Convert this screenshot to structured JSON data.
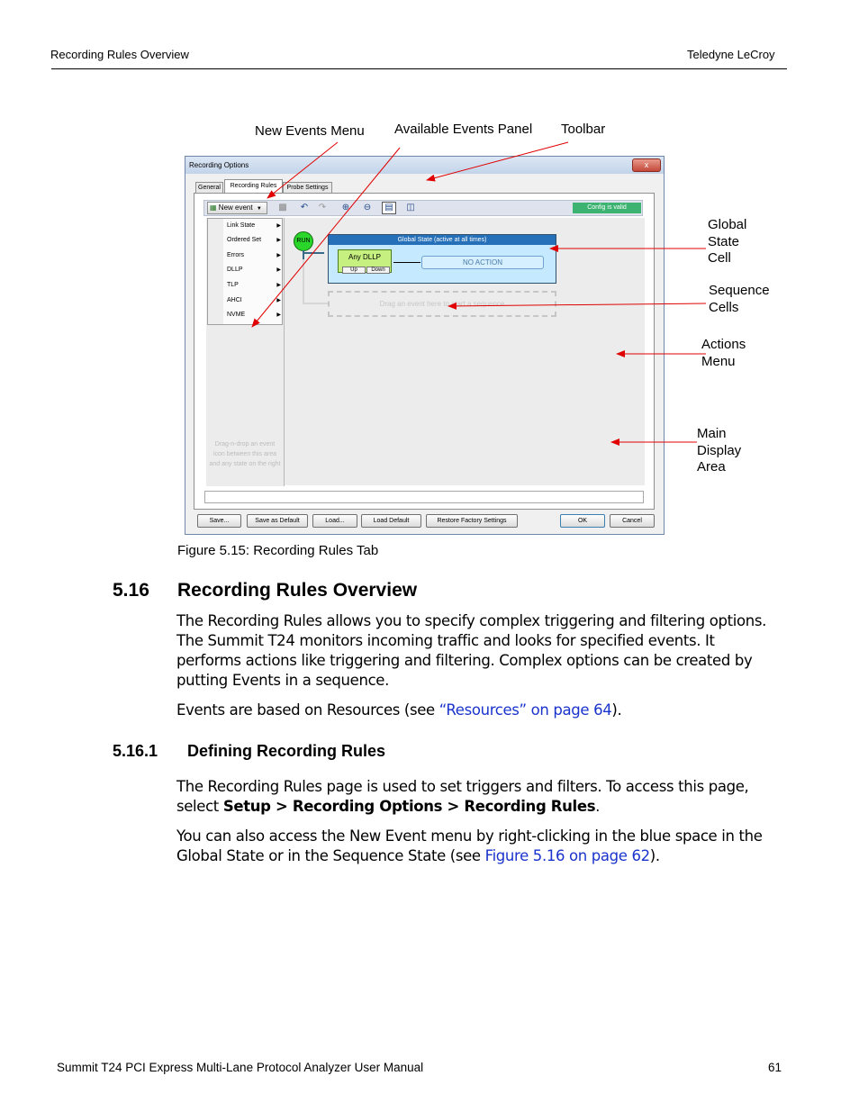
{
  "header": {
    "left": "Recording Rules Overview",
    "right": "Teledyne LeCroy"
  },
  "figure": {
    "callouts": {
      "new_events_menu": "New Events Menu",
      "available_events_panel": "Available Events Panel",
      "toolbar": "Toolbar",
      "global_state_cell": [
        "Global",
        "State",
        "Cell"
      ],
      "sequence_cells": [
        "Sequence",
        "Cells"
      ],
      "actions_menu": [
        "Actions",
        "Menu"
      ],
      "main_display_area": [
        "Main",
        "Display",
        "Area"
      ]
    },
    "window": {
      "title": "Recording Options",
      "close_glyph": "x",
      "tabs": [
        "General",
        "Recording Rules",
        "Probe Settings"
      ],
      "new_event_label": "New event",
      "config_status": "Config is valid",
      "menu_items": [
        "Link State",
        "Ordered Set",
        "Errors",
        "DLLP",
        "TLP",
        "AHCI",
        "NVME"
      ],
      "left_hint": "Drag-n-drop an event icon between this area and any state on the right",
      "run_label": "RUN",
      "global_state_title": "Global State (active at all times)",
      "event_label": "Any DLLP",
      "up_label": "Up",
      "down_label": "Down",
      "action_label": "NO ACTION",
      "sequence_hint": "Drag an event here to start a sequence",
      "buttons": [
        "Save...",
        "Save as Default",
        "Load...",
        "Load Default",
        "Restore Factory Settings",
        "OK",
        "Cancel"
      ]
    },
    "caption": "Figure 5.15:  Recording Rules Tab"
  },
  "section": {
    "number": "5.16",
    "title": "Recording Rules Overview",
    "para1": "The Recording Rules allows you to specify complex triggering and filtering options. The Summit T24 monitors incoming traffic and looks for specified events. It performs actions like triggering and filtering. Complex options can be created by putting Events in a sequence.",
    "para2_prefix": "Events are based on Resources (see ",
    "para2_link": "“Resources” on page 64",
    "para2_suffix": ")."
  },
  "subsection": {
    "number": "5.16.1",
    "title": "Defining Recording Rules",
    "para1_prefix": "The Recording Rules page is used to set triggers and filters. To access this page, select ",
    "para1_bold": "Setup > Recording Options > Recording Rules",
    "para1_suffix": ".",
    "para2_prefix": "You can also access the New Event menu by right-clicking in the blue space in the Global State or in the Sequence State (see ",
    "para2_link": "Figure 5.16 on page 62",
    "para2_suffix": ")."
  },
  "footer": {
    "left": "Summit T24 PCI Express Multi-Lane Protocol Analyzer User Manual",
    "page_number": "61"
  },
  "colors": {
    "link": "#1a33cc",
    "callout_arrow": "#e00000",
    "global_state_fill": "#c5eaff",
    "global_state_title": "#2570b8",
    "event_fill": "#c6f080",
    "config_valid": "#3cb371"
  }
}
